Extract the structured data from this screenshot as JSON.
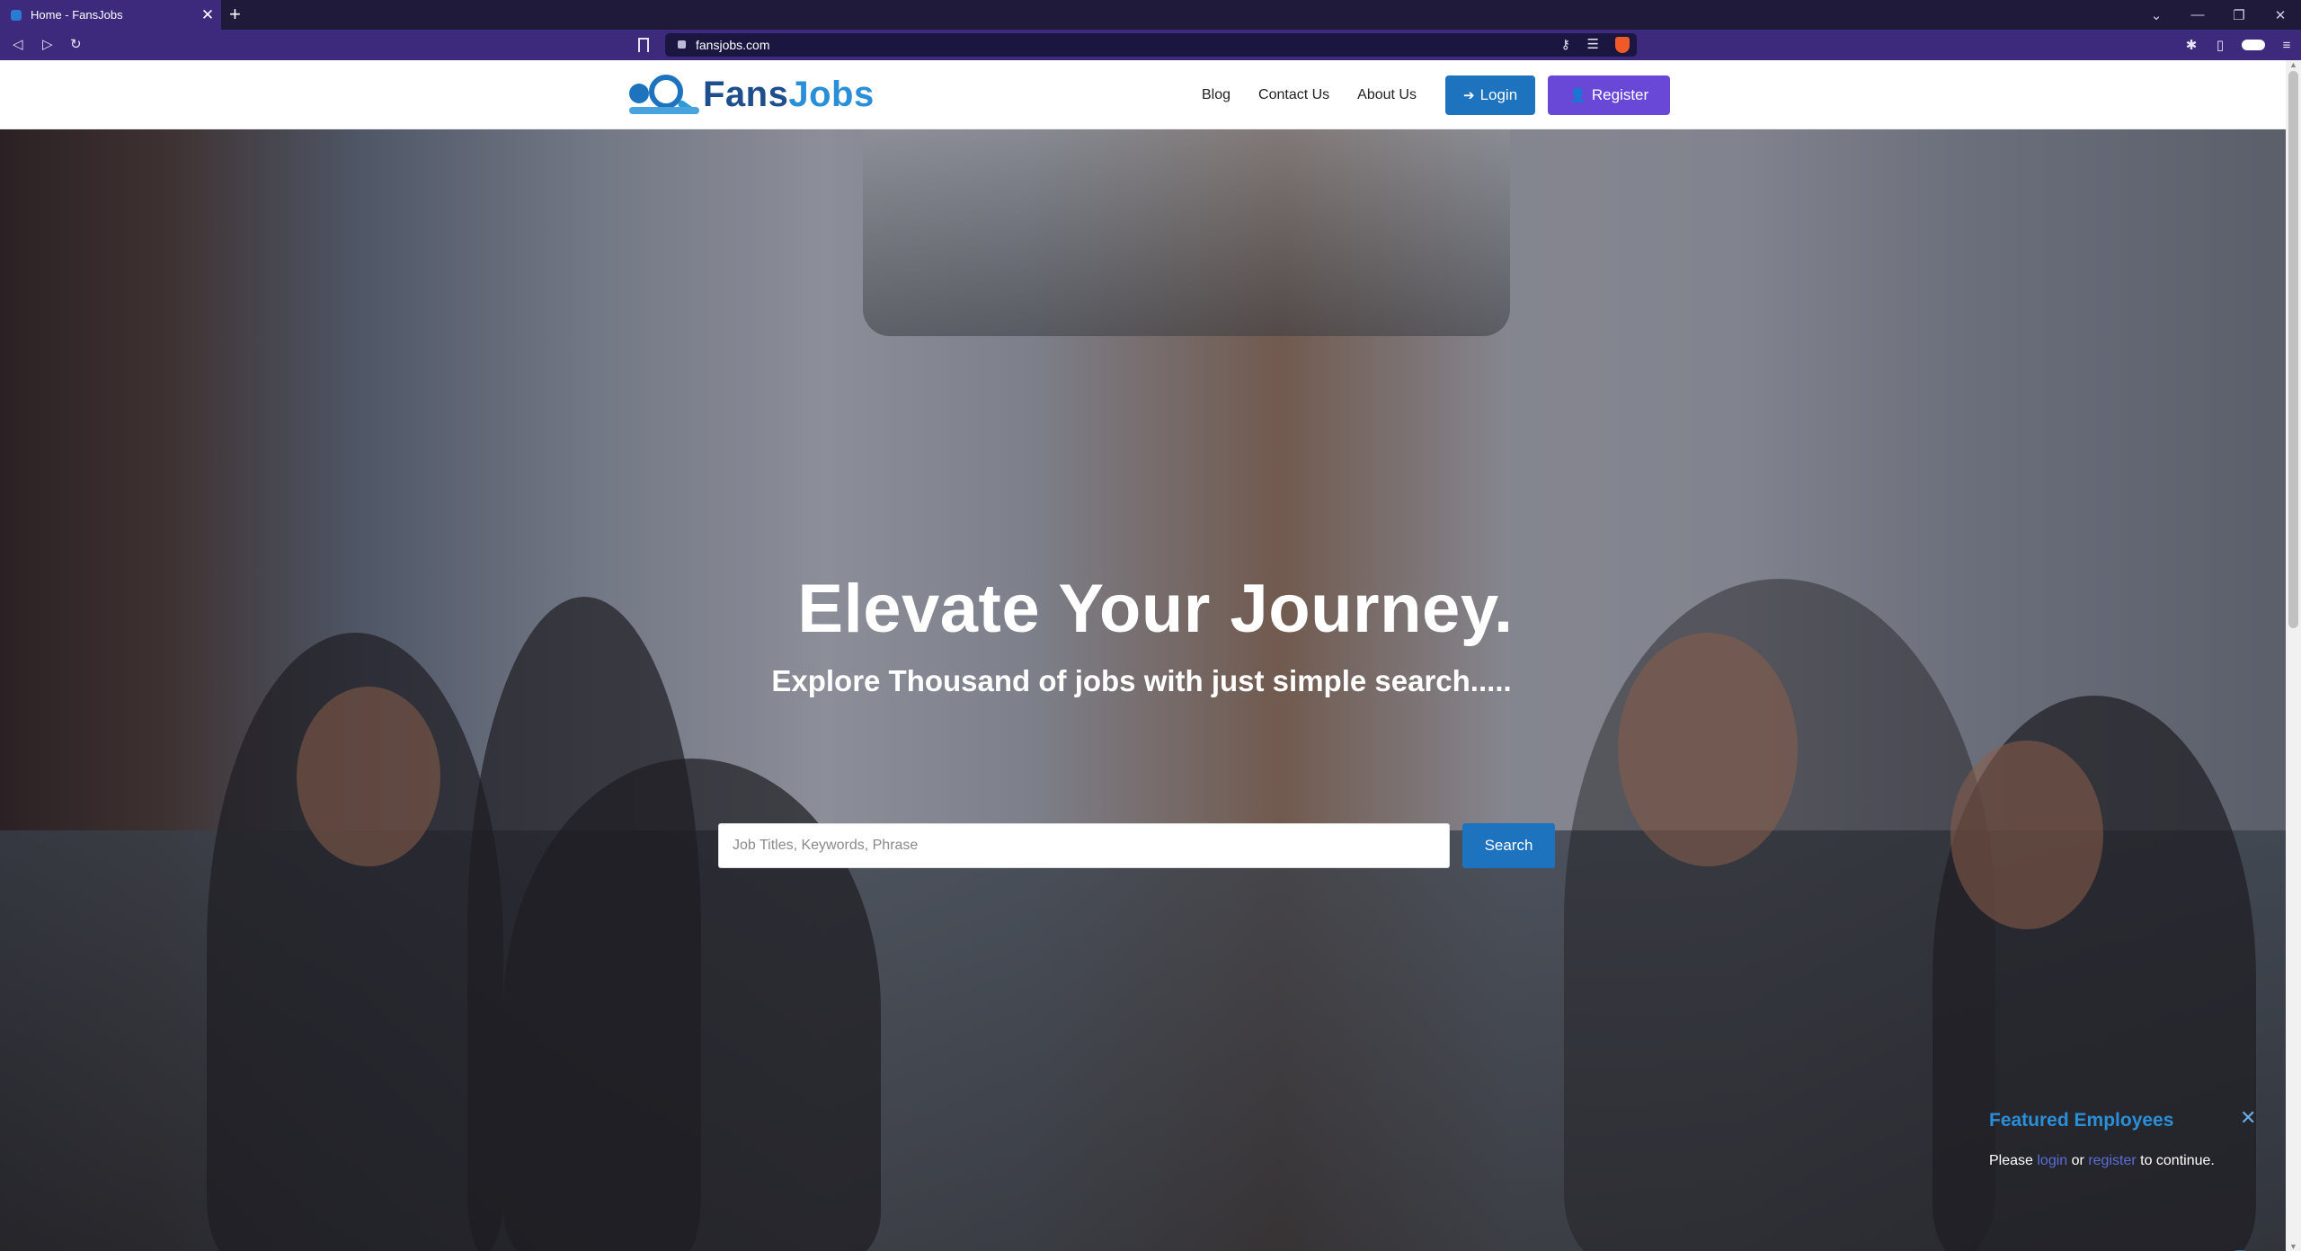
{
  "browser": {
    "tab_title": "Home - FansJobs",
    "tab_close": "✕",
    "new_tab": "+",
    "url": "fansjobs.com",
    "window_controls": [
      "⌄",
      "—",
      "❐",
      "✕"
    ],
    "nav": {
      "back": "◁",
      "forward": "▷",
      "reload": "↻"
    },
    "icons": [
      "bookmark-icon",
      "lock-icon",
      "key-icon",
      "reader-mode-icon",
      "brave-shield-icon",
      "extensions-icon",
      "sidebar-icon",
      "wallet-icon",
      "menu-icon"
    ]
  },
  "header": {
    "logo_fans": "Fans",
    "logo_jobs": "Jobs",
    "nav_links": [
      "Blog",
      "Contact Us",
      "About Us"
    ],
    "login_label": "Login",
    "register_label": "Register"
  },
  "hero": {
    "title": "Elevate Your Journey.",
    "subtitle": "Explore Thousand of jobs with just simple search.....",
    "search_placeholder": "Job Titles, Keywords, Phrase",
    "search_button": "Search"
  },
  "featured": {
    "title": "Featured Employees",
    "close": "✕",
    "msg_prefix": "Please ",
    "login_link": "login",
    "msg_middle": " or ",
    "register_link": "register",
    "msg_suffix": " to continue."
  },
  "colors": {
    "browser_frame": "#3d2a7d",
    "primary_blue": "#1e73be",
    "register_purple": "#6a48d7",
    "featured_title": "#2a8fd8"
  }
}
